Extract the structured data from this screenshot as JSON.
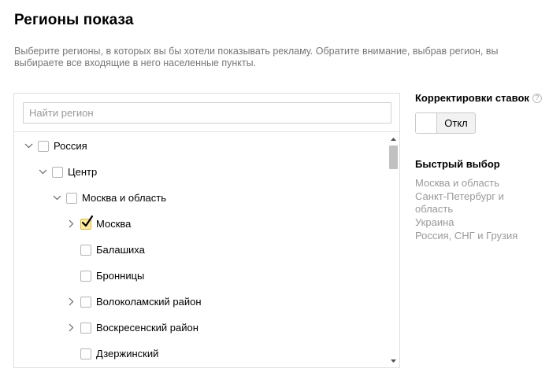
{
  "header": {
    "title": "Регионы показа",
    "description": "Выберите регионы, в которых вы бы хотели показывать рекламу. Обратите внимание, выбрав регион, вы выбираете все входящие в него населенные пункты."
  },
  "search": {
    "placeholder": "Найти регион",
    "value": ""
  },
  "tree": {
    "rows": [
      {
        "label": "Россия",
        "level": 0,
        "chevron": "chevron-down",
        "checked": false
      },
      {
        "label": "Центр",
        "level": 1,
        "chevron": "chevron-down",
        "checked": false
      },
      {
        "label": "Москва и область",
        "level": 2,
        "chevron": "chevron-down",
        "checked": false
      },
      {
        "label": "Москва",
        "level": 3,
        "chevron": "chevron-right",
        "checked": true
      },
      {
        "label": "Балашиха",
        "level": 3,
        "chevron": "none",
        "checked": false
      },
      {
        "label": "Бронницы",
        "level": 3,
        "chevron": "none",
        "checked": false
      },
      {
        "label": "Волоколамский район",
        "level": 3,
        "chevron": "chevron-right",
        "checked": false
      },
      {
        "label": "Воскресенский район",
        "level": 3,
        "chevron": "chevron-right",
        "checked": false
      },
      {
        "label": "Дзержинский",
        "level": 3,
        "chevron": "none",
        "checked": false
      }
    ]
  },
  "bid_adjustments": {
    "title": "Корректировки ставок",
    "help_icon": "question-circle-icon",
    "toggle_label": "Откл",
    "enabled": false
  },
  "quick_select": {
    "title": "Быстрый выбор",
    "links": [
      "Москва и область",
      "Санкт-Петербург и область",
      "Украина",
      "Россия, СНГ и Грузия"
    ]
  },
  "colors": {
    "checked_fill": "#ffeba0",
    "link": "#999999",
    "description": "#777777"
  }
}
